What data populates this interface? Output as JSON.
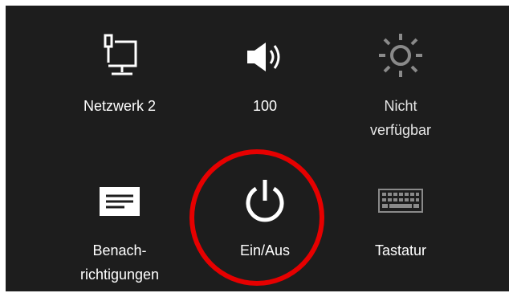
{
  "settings_panel": {
    "tiles": [
      {
        "label": "Netzwerk  2",
        "icon": "network-icon"
      },
      {
        "label": "100",
        "icon": "speaker-volume-icon"
      },
      {
        "label": "Nicht\nverfügbar",
        "icon": "brightness-icon"
      },
      {
        "label": "Benach-\nrichtigungen",
        "icon": "notifications-icon"
      },
      {
        "label": "Ein/Aus",
        "icon": "power-icon"
      },
      {
        "label": "Tastatur",
        "icon": "keyboard-icon"
      }
    ]
  },
  "colors": {
    "panel_background": "#1d1d1d",
    "text": "#ffffff",
    "highlight_ring": "#e60000",
    "disabled_icon": "#8a8a8a"
  }
}
